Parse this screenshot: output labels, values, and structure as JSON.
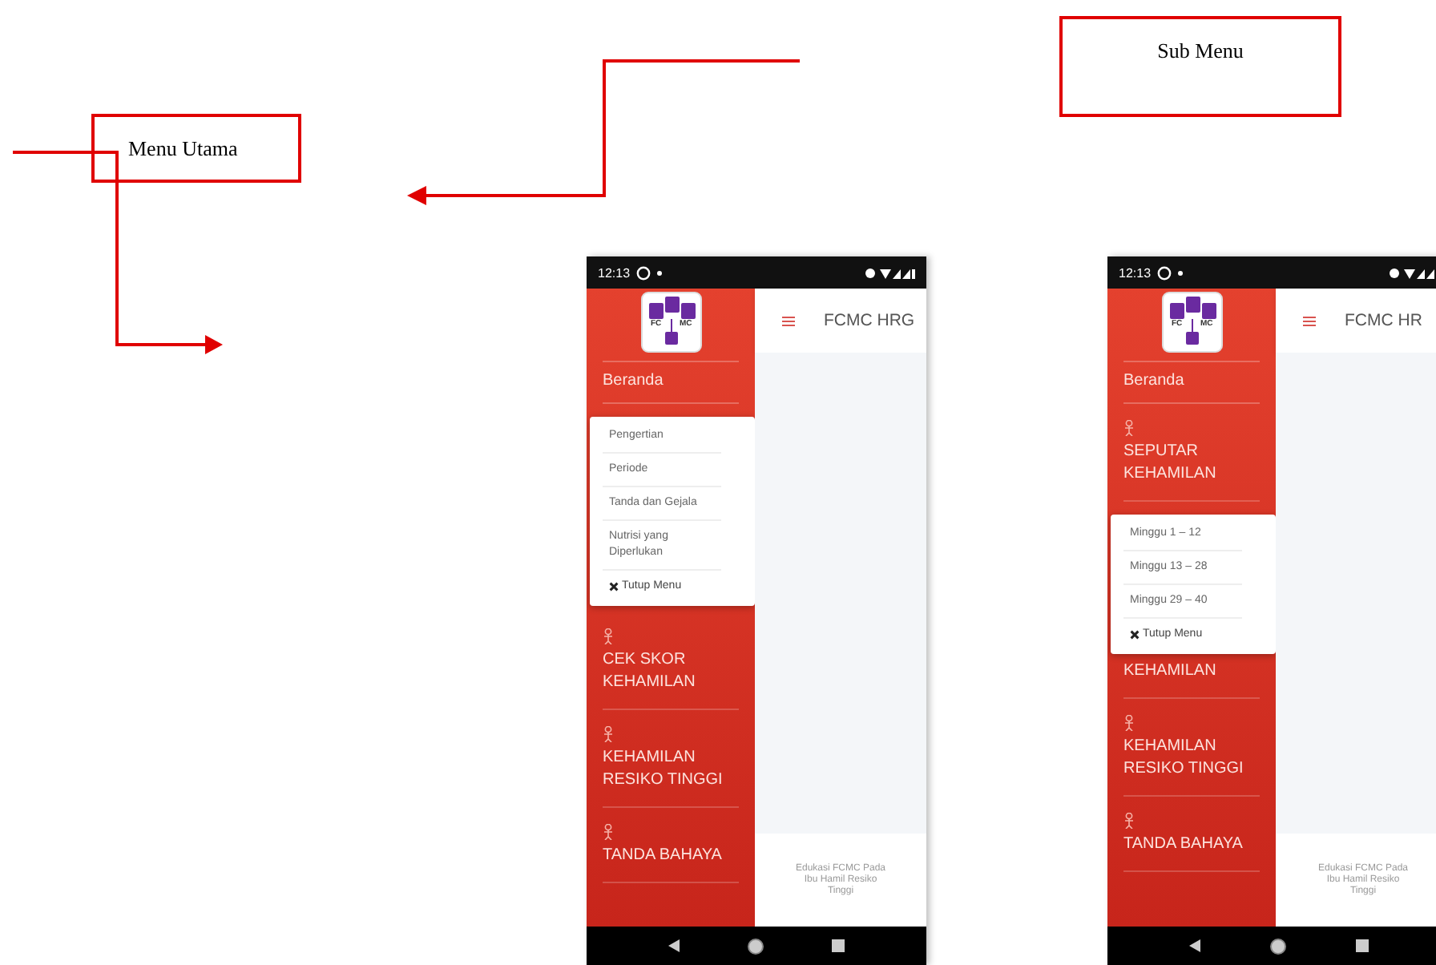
{
  "annotations": [
    {
      "kind": "label",
      "text": "Menu Utama"
    },
    {
      "kind": "label",
      "text": "Sub Menu"
    }
  ],
  "phones": [
    {
      "status_bar": {
        "time": "12:13"
      },
      "logo": {
        "left": "FC",
        "right": "MC"
      },
      "header": {
        "title": "FCMC HRG"
      },
      "sidebar": {
        "items": [
          {
            "kind": "link",
            "label": "Beranda"
          },
          {
            "kind": "submenu",
            "items": [
              {
                "kind": "option",
                "label": "Pengertian"
              },
              {
                "kind": "option",
                "label": "Periode"
              },
              {
                "kind": "option",
                "label": "Tanda dan Gejala"
              },
              {
                "kind": "option",
                "label": "Nutrisi yang Diperlukan"
              },
              {
                "kind": "close",
                "label": "Tutup Menu"
              }
            ]
          },
          {
            "kind": "section",
            "icon": true,
            "label": "CEK SKOR KEHAMILAN"
          },
          {
            "kind": "section",
            "icon": true,
            "label": "KEHAMILAN RESIKO TINGGI"
          },
          {
            "kind": "section",
            "icon": true,
            "label": "TANDA BAHAYA"
          }
        ]
      },
      "footer": {
        "text": "Edukasi FCMC Pada Ibu Hamil Resiko Tinggi"
      }
    },
    {
      "status_bar": {
        "time": "12:13"
      },
      "logo": {
        "left": "FC",
        "right": "MC"
      },
      "header": {
        "title": "FCMC HR"
      },
      "sidebar": {
        "items": [
          {
            "kind": "link",
            "label": "Beranda"
          },
          {
            "kind": "section",
            "icon": true,
            "label": "SEPUTAR KEHAMILAN"
          },
          {
            "kind": "submenu",
            "items": [
              {
                "kind": "option",
                "label": "Minggu 1 – 12"
              },
              {
                "kind": "option",
                "label": "Minggu 13 – 28"
              },
              {
                "kind": "option",
                "label": "Minggu 29 – 40"
              },
              {
                "kind": "close",
                "label": "Tutup Menu"
              }
            ]
          },
          {
            "kind": "section",
            "icon": false,
            "label": "KEHAMILAN"
          },
          {
            "kind": "section",
            "icon": true,
            "label": "KEHAMILAN RESIKO TINGGI"
          },
          {
            "kind": "section",
            "icon": true,
            "label": "TANDA BAHAYA"
          }
        ]
      },
      "footer": {
        "text": "Edukasi FCMC Pada Ibu Hamil Resiko Tinggi"
      }
    }
  ]
}
